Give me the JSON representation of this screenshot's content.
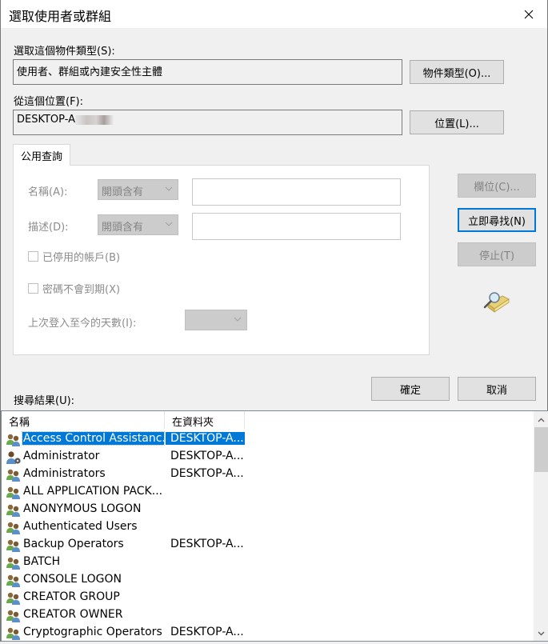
{
  "window": {
    "title": "選取使用者或群組",
    "close_icon": "close-icon"
  },
  "object_type": {
    "label": "選取這個物件類型(S):",
    "value": "使用者、群組或內建安全性主體",
    "button": "物件類型(O)..."
  },
  "location": {
    "label": "從這個位置(F):",
    "value": "DESKTOP-A",
    "button": "位置(L)..."
  },
  "tab": {
    "label": "公用查詢"
  },
  "query": {
    "name_label": "名稱(A):",
    "name_match": "開頭含有",
    "name_value": "",
    "desc_label": "描述(D):",
    "desc_match": "開頭含有",
    "desc_value": "",
    "disabled_accounts_label": "已停用的帳戶(B)",
    "disabled_accounts_checked": false,
    "non_expiring_pw_label": "密碼不會到期(X)",
    "non_expiring_pw_checked": false,
    "days_since_logon_label": "上次登入至今的天數(I):",
    "days_since_logon_value": ""
  },
  "side_buttons": {
    "columns": "欄位(C)...",
    "find_now": "立即尋找(N)",
    "stop": "停止(T)",
    "search_icon": "search-animation-icon"
  },
  "dialog_buttons": {
    "ok": "確定",
    "cancel": "取消"
  },
  "results": {
    "label": "搜尋結果(U):",
    "columns": [
      "名稱",
      "在資料夾"
    ],
    "rows": [
      {
        "name": "Access Control Assistanc...",
        "folder": "DESKTOP-A...",
        "icon": "group-icon",
        "selected": true
      },
      {
        "name": "Administrator",
        "folder": "DESKTOP-A...",
        "icon": "user-icon",
        "selected": false
      },
      {
        "name": "Administrators",
        "folder": "DESKTOP-A...",
        "icon": "group-icon",
        "selected": false
      },
      {
        "name": "ALL APPLICATION PACK...",
        "folder": "",
        "icon": "group-icon",
        "selected": false
      },
      {
        "name": "ANONYMOUS LOGON",
        "folder": "",
        "icon": "group-icon",
        "selected": false
      },
      {
        "name": "Authenticated Users",
        "folder": "",
        "icon": "group-icon",
        "selected": false
      },
      {
        "name": "Backup Operators",
        "folder": "DESKTOP-A...",
        "icon": "group-icon",
        "selected": false
      },
      {
        "name": "BATCH",
        "folder": "",
        "icon": "group-icon",
        "selected": false
      },
      {
        "name": "CONSOLE LOGON",
        "folder": "",
        "icon": "group-icon",
        "selected": false
      },
      {
        "name": "CREATOR GROUP",
        "folder": "",
        "icon": "group-icon",
        "selected": false
      },
      {
        "name": "CREATOR OWNER",
        "folder": "",
        "icon": "group-icon",
        "selected": false
      },
      {
        "name": "Cryptographic Operators",
        "folder": "DESKTOP-A...",
        "icon": "group-icon",
        "selected": false
      }
    ]
  },
  "colors": {
    "accent": "#0078d7",
    "dialog_bg": "#f0f0f0",
    "disabled_text": "#838383"
  }
}
